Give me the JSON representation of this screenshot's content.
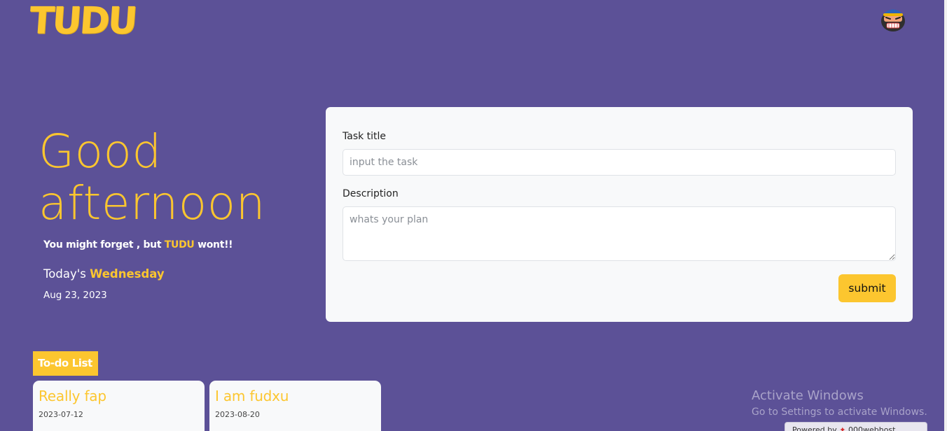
{
  "app": {
    "logo_text": "TUDU"
  },
  "colors": {
    "background": "#5c5197",
    "accent": "#fcc62f",
    "card": "#f8f9fa"
  },
  "header": {
    "avatar_icon": "angry-character-avatar-icon"
  },
  "hero": {
    "greeting_line1": "Good",
    "greeting_line2": "afternoon",
    "tagline_before": "You might forget , but ",
    "tagline_brand": "TUDU",
    "tagline_after": " wont!!",
    "today_prefix": "Today's ",
    "today_day": "Wednesday",
    "date": "Aug 23, 2023"
  },
  "form": {
    "title_label": "Task title",
    "title_placeholder": "input the task",
    "title_value": "",
    "description_label": "Description",
    "description_placeholder": "whats your plan",
    "description_value": "",
    "submit_label": "submit"
  },
  "todo": {
    "heading": "To-do List",
    "items": [
      {
        "title": "Really fap",
        "date": "2023-07-12"
      },
      {
        "title": "I am fudxu",
        "date": "2023-08-20"
      }
    ]
  },
  "overlay": {
    "activate_title": "Activate Windows",
    "activate_sub": "Go to Settings to activate Windows.",
    "powered_by": "Powered by",
    "powered_brand": "000webhost"
  }
}
